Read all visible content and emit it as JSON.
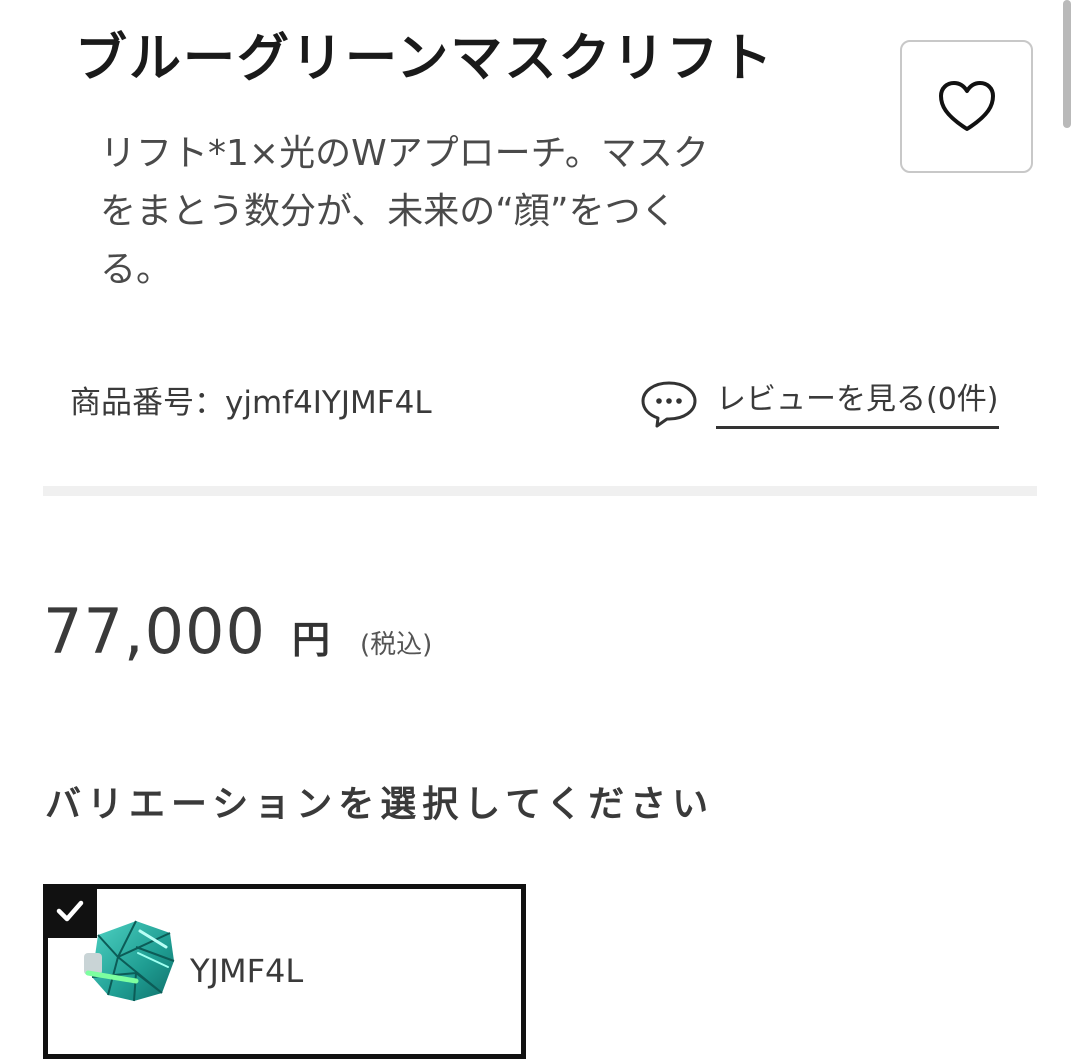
{
  "product": {
    "title": "ブルーグリーンマスクリフト",
    "description_lines": [
      "リフト*1×光のWアプローチ。マスク",
      "をまとう数分が、未来の“顔”をつく",
      "る。"
    ],
    "product_code": "商品番号：yjmf4IYJMF4L",
    "review_link_label": "レビューを見る(0件)"
  },
  "price": {
    "amount": "77,000",
    "currency": "円",
    "tax_note": "(税込)"
  },
  "variation": {
    "heading": "バリエーションを選択してください",
    "options": [
      {
        "label": "YJMF4L",
        "selected": true
      }
    ]
  },
  "icons": {
    "favorite": "heart-icon",
    "review": "chat-bubble-icon",
    "selected": "checkmark-icon",
    "variant_thumbnail": "mask-thumbnail"
  },
  "colors": {
    "text": "#333333",
    "selected_border": "#111111",
    "divider": "#f0f0f0",
    "mask_teal": "#2bb5a8",
    "mask_glow": "#7dffa0"
  }
}
